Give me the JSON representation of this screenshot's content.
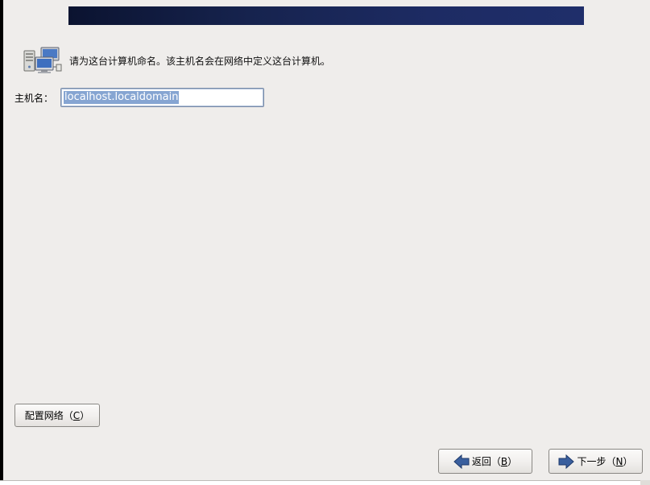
{
  "intro": {
    "icon": "network-computers-icon",
    "text": "请为这台计算机命名。该主机名会在网络中定义这台计算机。"
  },
  "hostname": {
    "label": "主机名：",
    "value": "localhost.localdomain"
  },
  "buttons": {
    "configure_network": {
      "text": "配置网络（",
      "mnemonic": "C",
      "close": "）"
    },
    "back": {
      "text": "返回（",
      "mnemonic": "B",
      "close": "）",
      "icon": "arrow-left-icon"
    },
    "next": {
      "text": "下一步（",
      "mnemonic": "N",
      "close": "）",
      "icon": "arrow-right-icon"
    }
  },
  "colors": {
    "window_bg": "#efedeb",
    "banner_dark": "#0b1330",
    "banner_light": "#1f2e6a",
    "selection": "#86a5d2",
    "arrow_blue": "#3a5f9e"
  }
}
